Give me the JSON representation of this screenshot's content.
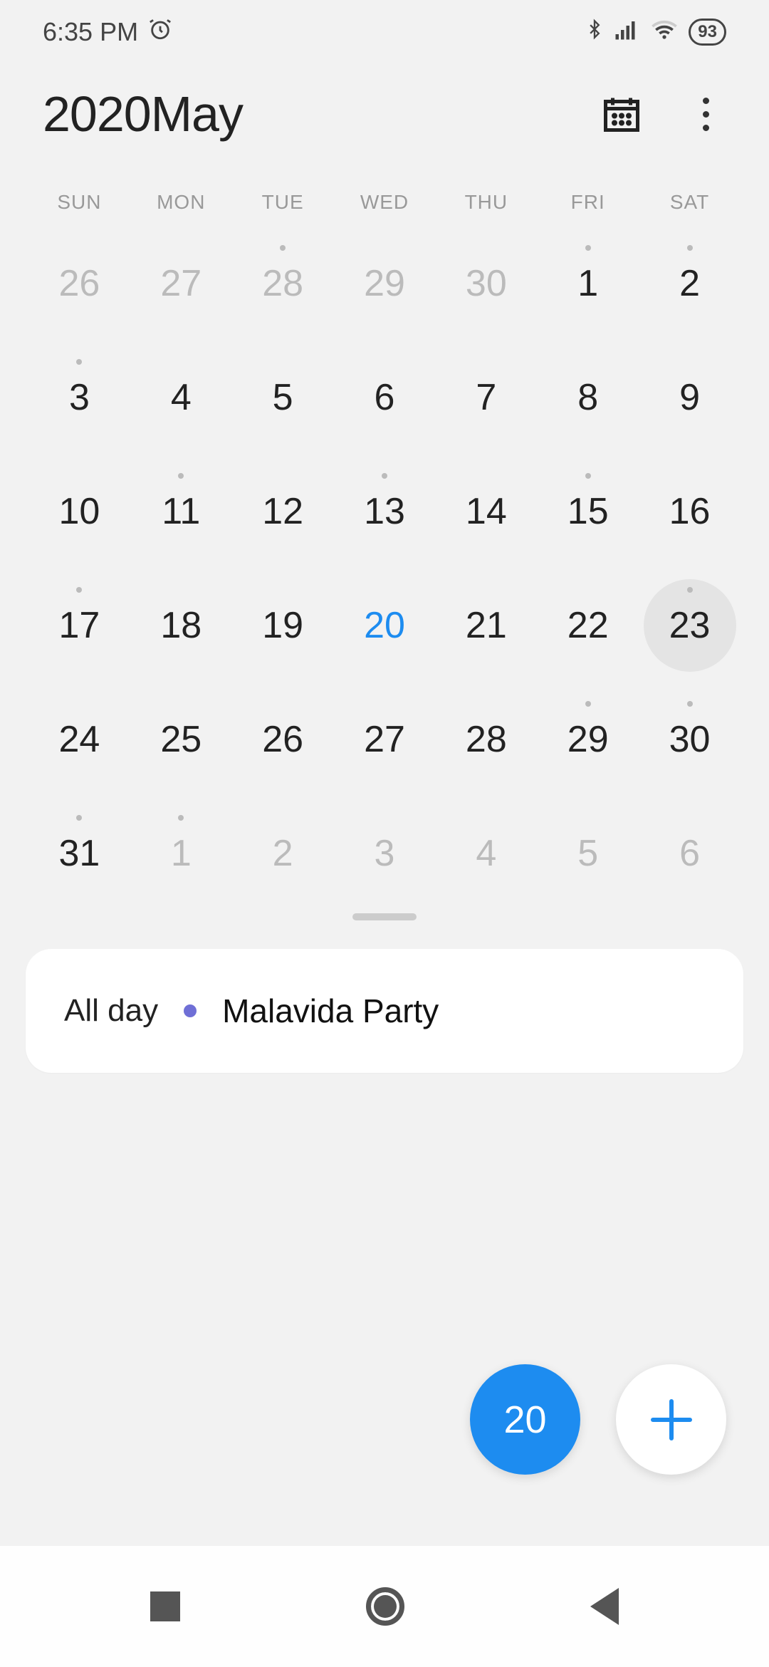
{
  "status_bar": {
    "time": "6:35 PM",
    "battery": "93"
  },
  "header": {
    "title": "2020May"
  },
  "weekdays": [
    "SUN",
    "MON",
    "TUE",
    "WED",
    "THU",
    "FRI",
    "SAT"
  ],
  "calendar": {
    "today_number": "20",
    "weeks": [
      [
        {
          "n": "26",
          "out": true
        },
        {
          "n": "27",
          "out": true
        },
        {
          "n": "28",
          "out": true,
          "dot": true
        },
        {
          "n": "29",
          "out": true
        },
        {
          "n": "30",
          "out": true
        },
        {
          "n": "1",
          "dot": true
        },
        {
          "n": "2",
          "dot": true
        }
      ],
      [
        {
          "n": "3",
          "dot": true
        },
        {
          "n": "4"
        },
        {
          "n": "5"
        },
        {
          "n": "6"
        },
        {
          "n": "7"
        },
        {
          "n": "8"
        },
        {
          "n": "9"
        }
      ],
      [
        {
          "n": "10"
        },
        {
          "n": "11",
          "dot": true
        },
        {
          "n": "12"
        },
        {
          "n": "13",
          "dot": true
        },
        {
          "n": "14"
        },
        {
          "n": "15",
          "dot": true
        },
        {
          "n": "16"
        }
      ],
      [
        {
          "n": "17",
          "dot": true
        },
        {
          "n": "18"
        },
        {
          "n": "19"
        },
        {
          "n": "20",
          "today": true
        },
        {
          "n": "21"
        },
        {
          "n": "22"
        },
        {
          "n": "23",
          "dot": true,
          "selected": true
        }
      ],
      [
        {
          "n": "24"
        },
        {
          "n": "25"
        },
        {
          "n": "26"
        },
        {
          "n": "27"
        },
        {
          "n": "28"
        },
        {
          "n": "29",
          "dot": true
        },
        {
          "n": "30",
          "dot": true
        }
      ],
      [
        {
          "n": "31",
          "dot": true
        },
        {
          "n": "1",
          "out": true,
          "dot": true
        },
        {
          "n": "2",
          "out": true
        },
        {
          "n": "3",
          "out": true
        },
        {
          "n": "4",
          "out": true
        },
        {
          "n": "5",
          "out": true
        },
        {
          "n": "6",
          "out": true
        }
      ]
    ]
  },
  "event": {
    "time_label": "All day",
    "title": "Malavida Party",
    "color": "#6f6fd6"
  },
  "fab": {
    "today_number": "20"
  }
}
